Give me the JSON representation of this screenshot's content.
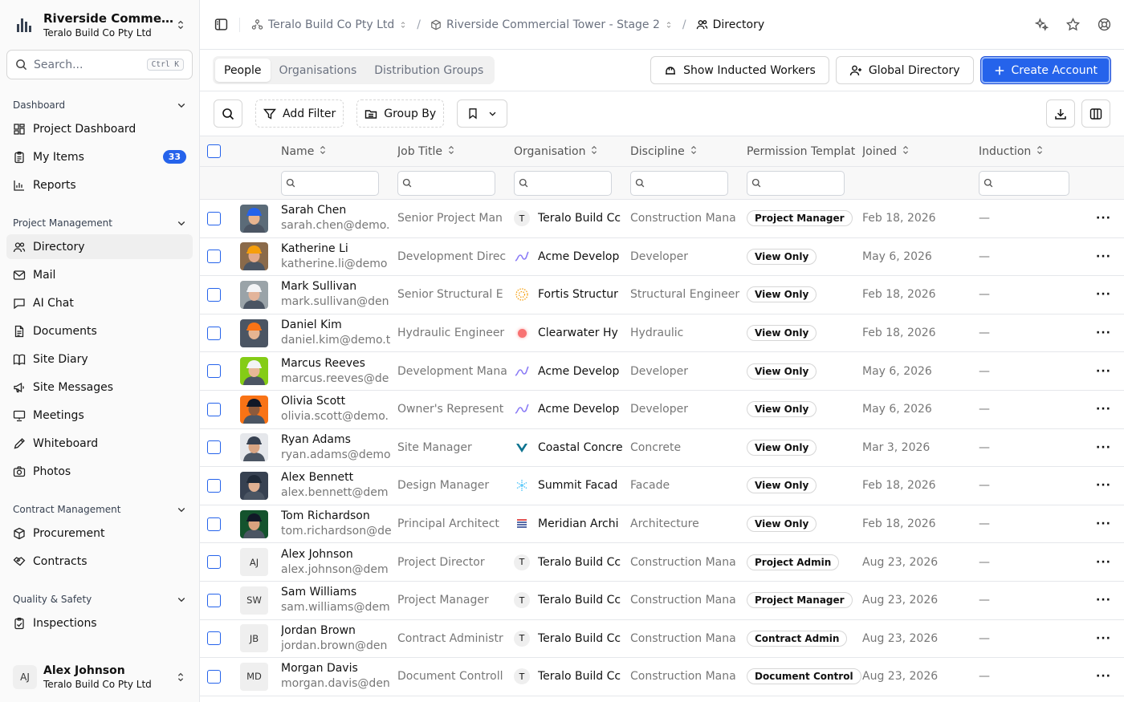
{
  "project": {
    "name": "Riverside Commer...",
    "org": "Teralo Build Co Pty Ltd"
  },
  "search": {
    "placeholder": "Search...",
    "shortcut": "Ctrl K"
  },
  "nav": [
    {
      "section": "Dashboard",
      "items": [
        {
          "label": "Project Dashboard",
          "icon": "dashboard-icon"
        },
        {
          "label": "My Items",
          "icon": "clipboard-icon",
          "badge": "33"
        },
        {
          "label": "Reports",
          "icon": "chart-icon"
        }
      ]
    },
    {
      "section": "Project Management",
      "items": [
        {
          "label": "Directory",
          "icon": "users-icon",
          "active": true
        },
        {
          "label": "Mail",
          "icon": "mail-icon"
        },
        {
          "label": "AI Chat",
          "icon": "chat-icon"
        },
        {
          "label": "Documents",
          "icon": "document-icon"
        },
        {
          "label": "Site Diary",
          "icon": "book-icon"
        },
        {
          "label": "Site Messages",
          "icon": "megaphone-icon"
        },
        {
          "label": "Meetings",
          "icon": "presentation-icon"
        },
        {
          "label": "Whiteboard",
          "icon": "pen-icon"
        },
        {
          "label": "Photos",
          "icon": "camera-icon"
        }
      ]
    },
    {
      "section": "Contract Management",
      "items": [
        {
          "label": "Procurement",
          "icon": "package-icon"
        },
        {
          "label": "Contracts",
          "icon": "handshake-icon"
        }
      ]
    },
    {
      "section": "Quality & Safety",
      "items": [
        {
          "label": "Inspections",
          "icon": "clipboard-check-icon"
        }
      ]
    }
  ],
  "user": {
    "initials": "AJ",
    "name": "Alex Johnson",
    "org": "Teralo Build Co Pty Ltd"
  },
  "breadcrumb": {
    "org": "Teralo Build Co Pty Ltd",
    "project": "Riverside Commercial Tower - Stage 2",
    "page": "Directory"
  },
  "tabs": [
    "People",
    "Organisations",
    "Distribution Groups"
  ],
  "actions": {
    "inducted": "Show Inducted Workers",
    "global": "Global Directory",
    "create": "Create Account"
  },
  "filters": {
    "add_filter": "Add Filter",
    "group_by": "Group By"
  },
  "columns": {
    "name": "Name",
    "job": "Job Title",
    "org": "Organisation",
    "discipline": "Discipline",
    "permission": "Permission Templat",
    "joined": "Joined",
    "induction": "Induction"
  },
  "people": [
    {
      "name": "Sarah Chen",
      "email": "sarah.chen@demo.",
      "job": "Senior Project Man",
      "org": "Teralo Build Cc",
      "orgLogo": "T",
      "discipline": "Construction Mana",
      "permission": "Project Manager",
      "joined": "Feb 18, 2026",
      "induction": "—",
      "avatar": "photo",
      "hat": "#2563eb",
      "skin": "#e8b48f",
      "bg": "#5b6b78"
    },
    {
      "name": "Katherine Li",
      "email": "katherine.li@demo",
      "job": "Development Direc",
      "org": "Acme Develop",
      "orgLogo": "wave",
      "discipline": "Developer",
      "permission": "View Only",
      "joined": "May 6, 2026",
      "induction": "—",
      "avatar": "photo",
      "hat": "#f59e0b",
      "skin": "#e2a98a",
      "bg": "#8a6a4a"
    },
    {
      "name": "Mark Sullivan",
      "email": "mark.sullivan@den",
      "job": "Senior Structural E",
      "org": "Fortis Structur",
      "orgLogo": "sun",
      "discipline": "Structural Engineer",
      "permission": "View Only",
      "joined": "Feb 18, 2026",
      "induction": "—",
      "avatar": "photo",
      "hat": "#f3f4f6",
      "skin": "#e3b49a",
      "bg": "#9aa3a8"
    },
    {
      "name": "Daniel Kim",
      "email": "daniel.kim@demo.t",
      "job": "Hydraulic Engineer",
      "org": "Clearwater Hy",
      "orgLogo": "dot",
      "discipline": "Hydraulic",
      "permission": "View Only",
      "joined": "Feb 18, 2026",
      "induction": "—",
      "avatar": "photo",
      "hat": "#f97316",
      "skin": "#e6b592",
      "bg": "#4b5563"
    },
    {
      "name": "Marcus Reeves",
      "email": "marcus.reeves@de",
      "job": "Development Mana",
      "org": "Acme Develop",
      "orgLogo": "wave",
      "discipline": "Developer",
      "permission": "View Only",
      "joined": "May 6, 2026",
      "induction": "—",
      "avatar": "photo",
      "hat": "#f3f4f6",
      "skin": "#e7b797",
      "bg": "#84cc16"
    },
    {
      "name": "Olivia Scott",
      "email": "olivia.scott@demo.",
      "job": "Owner's Represent",
      "org": "Acme Develop",
      "orgLogo": "wave",
      "discipline": "Developer",
      "permission": "View Only",
      "joined": "May 6, 2026",
      "induction": "—",
      "avatar": "photo",
      "hat": "#111827",
      "skin": "#8d5a3b",
      "bg": "#f97316"
    },
    {
      "name": "Ryan Adams",
      "email": "ryan.adams@demo",
      "job": "Site Manager",
      "org": "Coastal Concre",
      "orgLogo": "v",
      "discipline": "Concrete",
      "permission": "View Only",
      "joined": "Mar 3, 2026",
      "induction": "—",
      "avatar": "photo",
      "hat": "#374151",
      "skin": "#d9a583",
      "bg": "#e5e7eb"
    },
    {
      "name": "Alex Bennett",
      "email": "alex.bennett@dem",
      "job": "Design Manager",
      "org": "Summit Facad",
      "orgLogo": "snow",
      "discipline": "Facade",
      "permission": "View Only",
      "joined": "Feb 18, 2026",
      "induction": "—",
      "avatar": "photo",
      "hat": "#1f2937",
      "skin": "#e0b092",
      "bg": "#374151"
    },
    {
      "name": "Tom Richardson",
      "email": "tom.richardson@de",
      "job": "Principal Architect",
      "org": "Meridian Archi",
      "orgLogo": "lines",
      "discipline": "Architecture",
      "permission": "View Only",
      "joined": "Feb 18, 2026",
      "induction": "—",
      "avatar": "photo",
      "hat": "#111827",
      "skin": "#d8a27e",
      "bg": "#14532d"
    },
    {
      "name": "Alex Johnson",
      "email": "alex.johnson@dem",
      "job": "Project Director",
      "org": "Teralo Build Cc",
      "orgLogo": "T",
      "discipline": "Construction Mana",
      "permission": "Project Admin",
      "joined": "Aug 23, 2026",
      "induction": "—",
      "avatar": "AJ"
    },
    {
      "name": "Sam Williams",
      "email": "sam.williams@dem",
      "job": "Project Manager",
      "org": "Teralo Build Cc",
      "orgLogo": "T",
      "discipline": "Construction Mana",
      "permission": "Project Manager",
      "joined": "Aug 23, 2026",
      "induction": "—",
      "avatar": "SW"
    },
    {
      "name": "Jordan Brown",
      "email": "jordan.brown@den",
      "job": "Contract Administr",
      "org": "Teralo Build Cc",
      "orgLogo": "T",
      "discipline": "Construction Mana",
      "permission": "Contract Admin",
      "joined": "Aug 23, 2026",
      "induction": "—",
      "avatar": "JB"
    },
    {
      "name": "Morgan Davis",
      "email": "morgan.davis@den",
      "job": "Document Controll",
      "org": "Teralo Build Cc",
      "orgLogo": "T",
      "discipline": "Construction Mana",
      "permission": "Document Control",
      "joined": "Aug 23, 2026",
      "induction": "—",
      "avatar": "MD"
    }
  ]
}
